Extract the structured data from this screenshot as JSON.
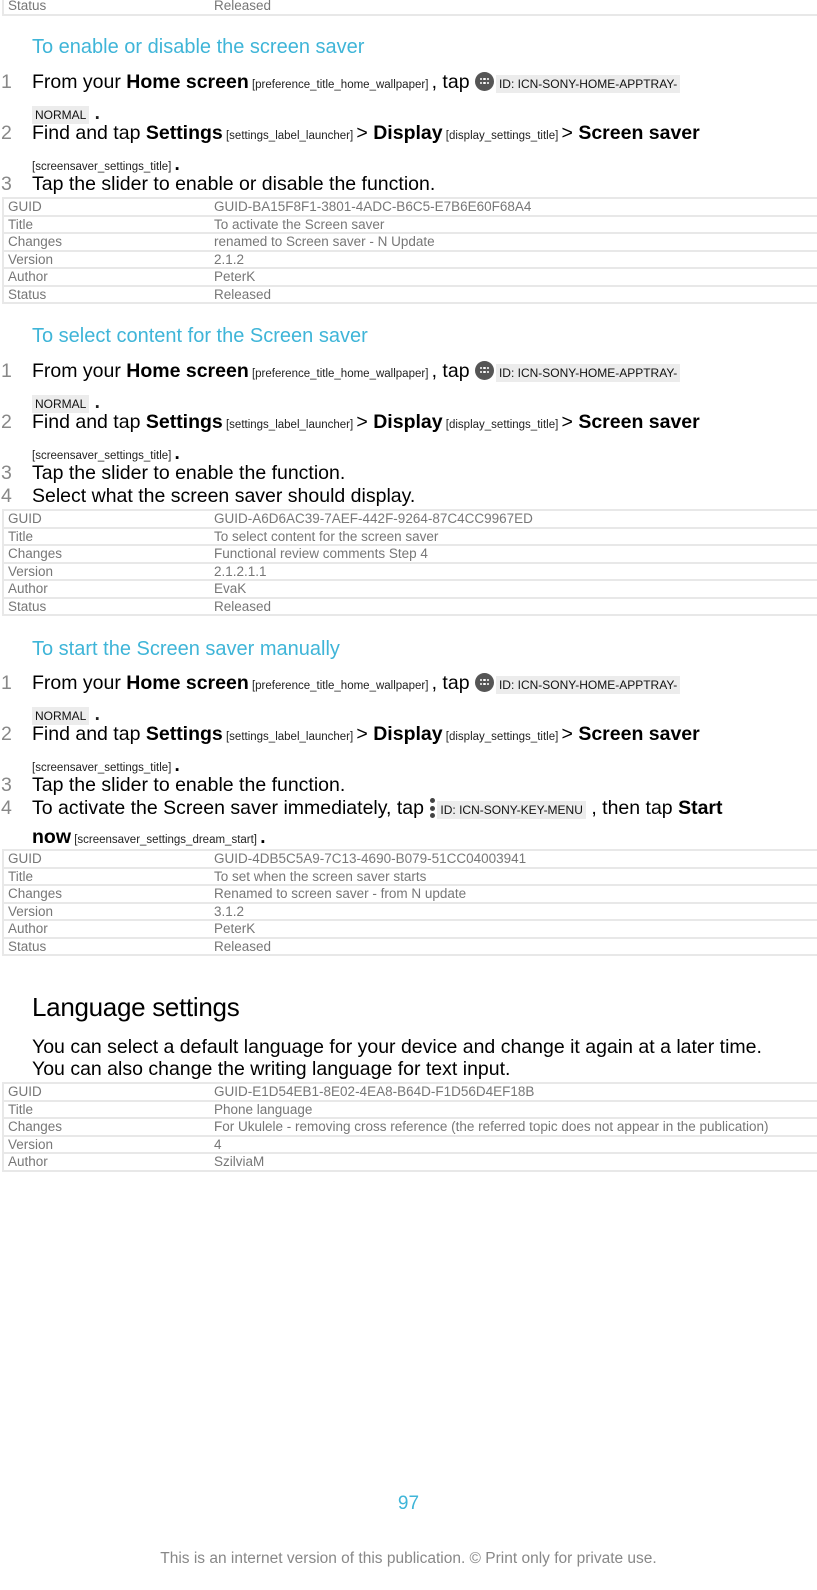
{
  "top_table": {
    "rows": [
      {
        "k": "Status",
        "v": "Released"
      }
    ]
  },
  "sections": [
    {
      "title": "To enable or disable the screen saver",
      "steps": [
        {
          "num": "1",
          "pre": "From your ",
          "b1": "Home screen",
          "r1": " [preference_title_home_wallpaper] ",
          "mid": ", tap ",
          "icon_id": "ID: ICN-SONY-HOME-APPTRAY-",
          "cont_id": "NORMAL",
          "cont_end": " ."
        },
        {
          "num": "2",
          "pre": "Find and tap ",
          "b1": "Settings",
          "r1": " [settings_label_launcher] ",
          "sep1": "> ",
          "b2": "Display",
          "r2": " [display_settings_title] ",
          "sep2": "> ",
          "b3": "Screen saver",
          "cont_ref": "[screensaver_settings_title] ",
          "cont_end": "."
        },
        {
          "num": "3",
          "text": "Tap the slider to enable or disable the function."
        }
      ],
      "table": [
        {
          "k": "GUID",
          "v": "GUID-BA15F8F1-3801-4ADC-B6C5-E7B6E60F68A4"
        },
        {
          "k": "Title",
          "v": "To activate the Screen saver"
        },
        {
          "k": "Changes",
          "v": "renamed to Screen saver - N Update"
        },
        {
          "k": "Version",
          "v": "2.1.2"
        },
        {
          "k": "Author",
          "v": "PeterK"
        },
        {
          "k": "Status",
          "v": "Released"
        }
      ]
    },
    {
      "title": "To select content for the Screen saver",
      "steps": [
        {
          "num": "1",
          "pre": "From your ",
          "b1": "Home screen",
          "r1": " [preference_title_home_wallpaper] ",
          "mid": ", tap ",
          "icon_id": "ID: ICN-SONY-HOME-APPTRAY-",
          "cont_id": "NORMAL",
          "cont_end": " ."
        },
        {
          "num": "2",
          "pre": "Find and tap ",
          "b1": "Settings",
          "r1": " [settings_label_launcher] ",
          "sep1": "> ",
          "b2": "Display",
          "r2": " [display_settings_title] ",
          "sep2": "> ",
          "b3": "Screen saver",
          "cont_ref": "[screensaver_settings_title] ",
          "cont_end": "."
        },
        {
          "num": "3",
          "text": "Tap the slider to enable the function."
        },
        {
          "num": "4",
          "text": "Select what the screen saver should display."
        }
      ],
      "table": [
        {
          "k": "GUID",
          "v": "GUID-A6D6AC39-7AEF-442F-9264-87C4CC9967ED"
        },
        {
          "k": "Title",
          "v": "To select content for the screen saver"
        },
        {
          "k": "Changes",
          "v": "Functional review comments Step 4"
        },
        {
          "k": "Version",
          "v": "2.1.2.1.1"
        },
        {
          "k": "Author",
          "v": "EvaK"
        },
        {
          "k": "Status",
          "v": "Released"
        }
      ]
    },
    {
      "title": "To start the Screen saver manually",
      "steps": [
        {
          "num": "1",
          "pre": "From your ",
          "b1": "Home screen",
          "r1": " [preference_title_home_wallpaper] ",
          "mid": ", tap ",
          "icon_id": "ID: ICN-SONY-HOME-APPTRAY-",
          "cont_id": "NORMAL",
          "cont_end": " ."
        },
        {
          "num": "2",
          "pre": "Find and tap ",
          "b1": "Settings",
          "r1": " [settings_label_launcher] ",
          "sep1": "> ",
          "b2": "Display",
          "r2": " [display_settings_title] ",
          "sep2": "> ",
          "b3": "Screen saver",
          "cont_ref": "[screensaver_settings_title] ",
          "cont_end": "."
        },
        {
          "num": "3",
          "text": "Tap the slider to enable the function."
        },
        {
          "num": "4",
          "pre": "To activate the Screen saver immediately, tap ",
          "icon_id": "ID: ICN-SONY-KEY-MENU",
          "mid": " , then tap ",
          "b1": "Start",
          "cont_b": "now",
          "cont_ref": " [screensaver_settings_dream_start] ",
          "cont_end": "."
        }
      ],
      "table": [
        {
          "k": "GUID",
          "v": "GUID-4DB5C5A9-7C13-4690-B079-51CC04003941"
        },
        {
          "k": "Title",
          "v": "To set when the screen saver starts"
        },
        {
          "k": "Changes",
          "v": "Renamed to screen saver - from N update"
        },
        {
          "k": "Version",
          "v": "3.1.2"
        },
        {
          "k": "Author",
          "v": "PeterK"
        },
        {
          "k": "Status",
          "v": "Released"
        }
      ]
    }
  ],
  "language": {
    "heading": "Language settings",
    "para_line1": "You can select a default language for your device and change it again at a later time.",
    "para_line2": "You can also change the writing language for text input.",
    "table": [
      {
        "k": "GUID",
        "v": "GUID-E1D54EB1-8E02-4EA8-B64D-F1D56D4EF18B"
      },
      {
        "k": "Title",
        "v": "Phone language"
      },
      {
        "k": "Changes",
        "v": "For Ukulele - removing cross reference (the referred topic does not appear in the publication)"
      },
      {
        "k": "Version",
        "v": "4"
      },
      {
        "k": "Author",
        "v": "SzilviaM"
      }
    ]
  },
  "page_number": "97",
  "footer": "This is an internet version of this publication. © Print only for private use.",
  "colors": {
    "heading_accent": "#3fb5d8",
    "meta_text": "#777777",
    "table_border": "#e8e8e8"
  }
}
